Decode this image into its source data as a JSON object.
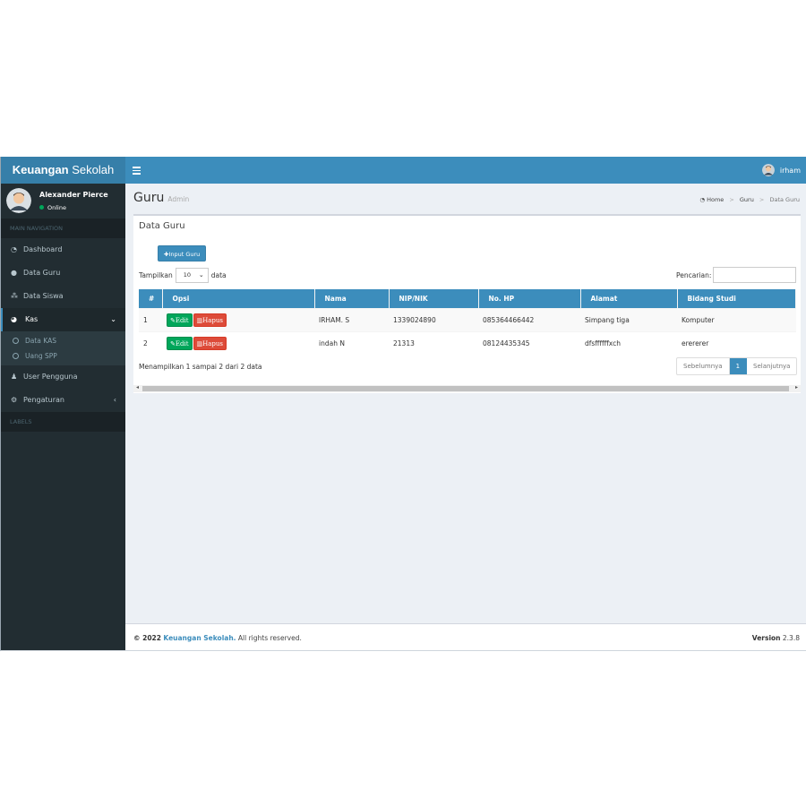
{
  "header": {
    "logo_bold": "Keuangan",
    "logo_rest": " Sekolah",
    "user_name": "irham"
  },
  "sidebar": {
    "user_name": "Alexander Pierce",
    "status": "Online",
    "nav_header": "MAIN NAVIGATION",
    "items": [
      {
        "label": "Dashboard",
        "icon": "dashboard-icon"
      },
      {
        "label": "Data Guru",
        "icon": "users-icon"
      },
      {
        "label": "Data Siswa",
        "icon": "sitemap-icon"
      },
      {
        "label": "Kas",
        "icon": "pie-chart-icon"
      }
    ],
    "sub_items": [
      {
        "label": "Data KAS"
      },
      {
        "label": "Uang SPP"
      }
    ],
    "items_after": [
      {
        "label": "User Pengguna",
        "icon": "user-icon"
      },
      {
        "label": "Pengaturan",
        "icon": "gears-icon"
      }
    ],
    "labels_header": "LABELS"
  },
  "page": {
    "title": "Guru",
    "subtitle": "Admin",
    "breadcrumb": [
      "Home",
      "Data Guru"
    ],
    "breadcrumb_mid": "Guru"
  },
  "box": {
    "title": "Data Guru",
    "input_button": "Input Guru",
    "show_label": "Tampilkan",
    "show_value": "10",
    "show_suffix": "data",
    "search_label": "Pencarian:",
    "columns": [
      "#",
      "Opsi",
      "Nama",
      "NIP/NIK",
      "No. HP",
      "Alamat",
      "Bidang Studi"
    ],
    "edit_label": "Edit",
    "delete_label": "Hapus",
    "rows": [
      {
        "no": "1",
        "nama": "IRHAM. S",
        "nip": "1339024890",
        "hp": "085364466442",
        "alamat": "Simpang tiga",
        "bidang": "Komputer"
      },
      {
        "no": "2",
        "nama": "indah N",
        "nip": "21313",
        "hp": "08124435345",
        "alamat": "dfsffffffxch",
        "bidang": "erererer"
      }
    ],
    "info": "Menampilkan 1 sampai 2 dari 2 data",
    "prev": "Sebelumnya",
    "page": "1",
    "next": "Selanjutnya"
  },
  "footer": {
    "copy": "© 2022",
    "brand": "Keuangan Sekolah.",
    "rest": " All rights reserved.",
    "version_label": "Version",
    "version": "2.3.8"
  },
  "colors": {
    "primary": "#3c8dbc",
    "sidebar": "#222d32",
    "success": "#00a65a",
    "danger": "#dd4b39"
  }
}
